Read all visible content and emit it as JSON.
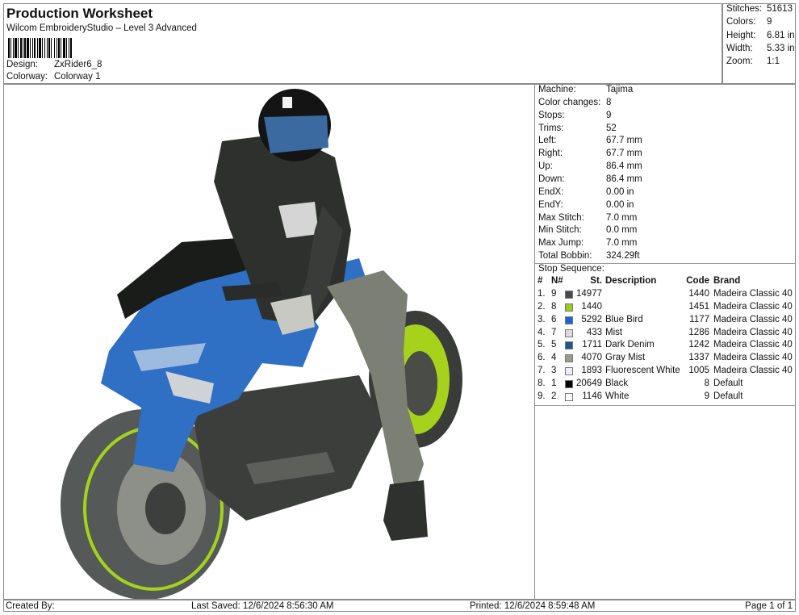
{
  "header": {
    "title": "Production Worksheet",
    "subtitle": "Wilcom EmbroideryStudio – Level 3 Advanced",
    "design_label": "Design:",
    "design_value": "ZxRider6_8",
    "colorway_label": "Colorway:",
    "colorway_value": "Colorway 1"
  },
  "stats": [
    {
      "label": "Stitches:",
      "value": "51613"
    },
    {
      "label": "Colors:",
      "value": "9"
    },
    {
      "label": "Height:",
      "value": "6.81 in"
    },
    {
      "label": "Width:",
      "value": "5.33 in"
    },
    {
      "label": "Zoom:",
      "value": "1:1"
    }
  ],
  "machine_info": [
    {
      "label": "Machine:",
      "value": "Tajima"
    },
    {
      "label": "Color changes:",
      "value": "8"
    },
    {
      "label": "Stops:",
      "value": "9"
    },
    {
      "label": "Trims:",
      "value": "52"
    },
    {
      "label": "Left:",
      "value": "67.7 mm"
    },
    {
      "label": "Right:",
      "value": "67.7 mm"
    },
    {
      "label": "Up:",
      "value": "86.4 mm"
    },
    {
      "label": "Down:",
      "value": "86.4 mm"
    },
    {
      "label": "EndX:",
      "value": "0.00 in"
    },
    {
      "label": "EndY:",
      "value": "0.00 in"
    },
    {
      "label": "Max Stitch:",
      "value": "7.0 mm"
    },
    {
      "label": "Min Stitch:",
      "value": "0.0 mm"
    },
    {
      "label": "Max Jump:",
      "value": "7.0 mm"
    },
    {
      "label": "Total Bobbin:",
      "value": "324.29ft"
    }
  ],
  "stop_sequence": {
    "title": "Stop Sequence:",
    "columns": {
      "idx": "#",
      "n": "N#",
      "st": "St.",
      "desc": "Description",
      "code": "Code",
      "brand": "Brand"
    },
    "rows": [
      {
        "idx": "1.",
        "n": "9",
        "color": "#4a4a4a",
        "st": "14977",
        "desc": "",
        "code": "1440",
        "brand": "Madeira Classic 40"
      },
      {
        "idx": "2.",
        "n": "8",
        "color": "#9ccc1a",
        "st": "1440",
        "desc": "",
        "code": "1451",
        "brand": "Madeira Classic 40"
      },
      {
        "idx": "3.",
        "n": "6",
        "color": "#1e63d4",
        "st": "5292",
        "desc": "Blue Bird",
        "code": "1177",
        "brand": "Madeira Classic 40"
      },
      {
        "idx": "4.",
        "n": "7",
        "color": "#dcdcdc",
        "st": "433",
        "desc": "Mist",
        "code": "1286",
        "brand": "Madeira Classic 40"
      },
      {
        "idx": "5.",
        "n": "5",
        "color": "#1f558f",
        "st": "1711",
        "desc": "Dark Denim",
        "code": "1242",
        "brand": "Madeira Classic 40"
      },
      {
        "idx": "6.",
        "n": "4",
        "color": "#9a9b8c",
        "st": "4070",
        "desc": "Gray Mist",
        "code": "1337",
        "brand": "Madeira Classic 40"
      },
      {
        "idx": "7.",
        "n": "3",
        "color": "#eceef8",
        "st": "1893",
        "desc": "Fluorescent White",
        "code": "1005",
        "brand": "Madeira Classic 40"
      },
      {
        "idx": "8.",
        "n": "1",
        "color": "#000000",
        "st": "20649",
        "desc": "Black",
        "code": "8",
        "brand": "Default"
      },
      {
        "idx": "9.",
        "n": "2",
        "color": "#ffffff",
        "st": "1146",
        "desc": "White",
        "code": "9",
        "brand": "Default"
      }
    ]
  },
  "footer": {
    "created_by": "Created By:",
    "last_saved": "Last Saved: 12/6/2024 8:56:30 AM",
    "printed": "Printed: 12/6/2024 8:59:48 AM",
    "page": "Page 1 of 1"
  },
  "design_preview": {
    "subject": "embroidery-design-motorcycle-rider",
    "colors": {
      "tire": "#505452",
      "rim_accent": "#a6d21c",
      "fairing": "#2f6fc4",
      "fairing_dark": "#1f4f8f",
      "body_dark": "#2e302e",
      "pants": "#7c7f73",
      "glove": "#c8c9c2",
      "visor": "#3b6aa0",
      "black": "#111111",
      "white": "#f2f2f2"
    }
  }
}
